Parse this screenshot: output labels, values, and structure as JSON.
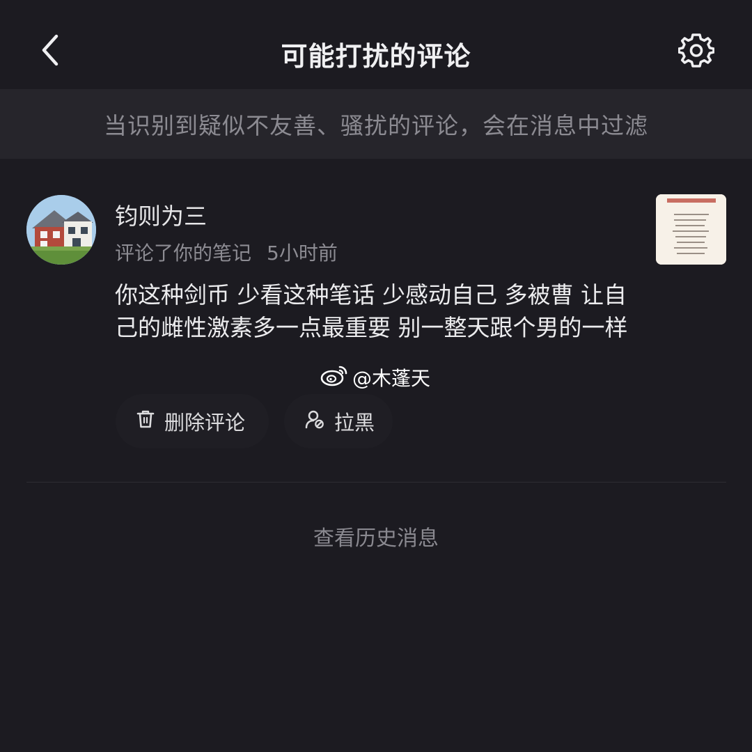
{
  "header": {
    "title": "可能打扰的评论",
    "back_icon": "chevron-left-icon",
    "settings_icon": "gear-icon"
  },
  "banner": {
    "text": "当识别到疑似不友善、骚扰的评论，会在消息中过滤"
  },
  "comment_item": {
    "username": "钧则为三",
    "action": "评论了你的笔记",
    "time": "5小时前",
    "text": "你这种剑币 少看这种笔话 少感动自己 多被曹 让自己的雌性激素多一点最重要 别一整天跟个男的一样",
    "avatar": "house-avatar",
    "thumbnail": "note-thumbnail",
    "actions": {
      "delete_label": "删除评论",
      "delete_icon": "trash-icon",
      "block_label": "拉黑",
      "block_icon": "block-user-icon"
    }
  },
  "watermark": {
    "text": "@木蓬天",
    "icon": "weibo-icon"
  },
  "footer": {
    "history_label": "查看历史消息"
  }
}
